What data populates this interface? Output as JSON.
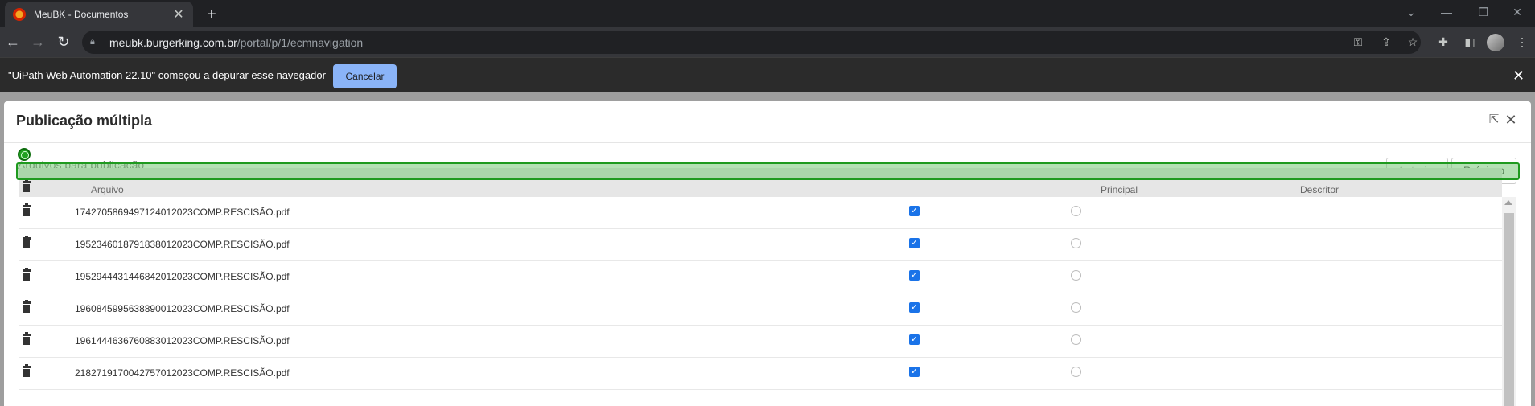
{
  "browser": {
    "tab_title": "MeuBK - Documentos",
    "tab_close": "✕",
    "new_tab": "+",
    "url_host": "meubk.burgerking.com.br",
    "url_path": "/portal/p/1/ecmnavigation",
    "window_controls": [
      "⌄",
      "—",
      "❐",
      "✕"
    ]
  },
  "debug_bar": {
    "message": "\"UiPath Web Automation 22.10\" começou a depurar esse navegador",
    "cancel_label": "Cancelar",
    "close": "✕"
  },
  "modal": {
    "title": "Publicação múltipla",
    "section_label": "Arquivos para publicação",
    "prev_label": "Anterior",
    "next_label": "Próximo",
    "columns": {
      "file": "Arquivo",
      "principal": "Principal",
      "descritor": "Descritor"
    },
    "rows": [
      {
        "file": "17427058694971240120​23COMP.RESCISÃO.pdf",
        "principal": true,
        "descritor": false
      },
      {
        "file": "19523460187918380120​23COMP.RESCISÃO.pdf",
        "principal": true,
        "descritor": false
      },
      {
        "file": "19529444314468420120​23COMP.RESCISÃO.pdf",
        "principal": true,
        "descritor": false
      },
      {
        "file": "19608459956388900120​23COMP.RESCISÃO.pdf",
        "principal": true,
        "descritor": false
      },
      {
        "file": "19614446367608830120​23COMP.RESCISÃO.pdf",
        "principal": true,
        "descritor": false
      },
      {
        "file": "21827191700427570120​23COMP.RESCISÃO.pdf",
        "principal": true,
        "descritor": false
      }
    ]
  }
}
